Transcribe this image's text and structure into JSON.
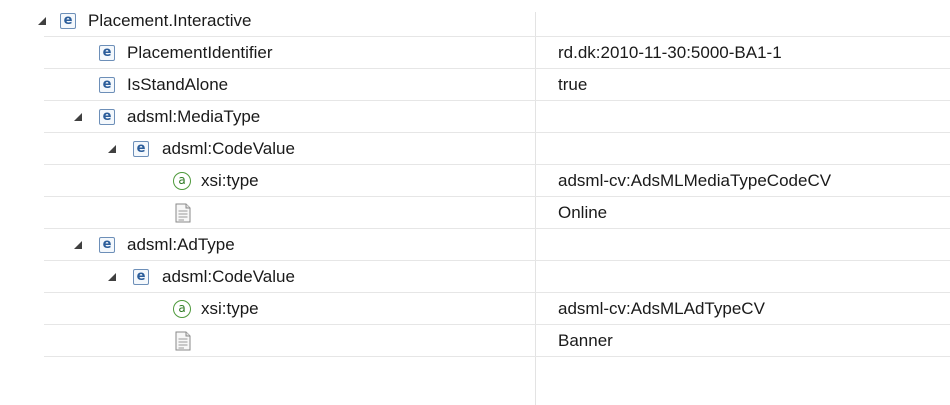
{
  "rows": [
    {
      "name": "Placement.Interactive",
      "value": "",
      "icon": "element",
      "expanded": true
    },
    {
      "name": "PlacementIdentifier",
      "value": "rd.dk:2010-11-30:5000-BA1-1",
      "icon": "element"
    },
    {
      "name": "IsStandAlone",
      "value": "true",
      "icon": "element"
    },
    {
      "name": "adsml:MediaType",
      "value": "",
      "icon": "element",
      "expanded": true
    },
    {
      "name": "adsml:CodeValue",
      "value": "",
      "icon": "element",
      "expanded": true
    },
    {
      "name": "xsi:type",
      "value": "adsml-cv:AdsMLMediaTypeCodeCV",
      "icon": "attribute"
    },
    {
      "name": "",
      "value": "Online",
      "icon": "text-node"
    },
    {
      "name": "adsml:AdType",
      "value": "",
      "icon": "element",
      "expanded": true
    },
    {
      "name": "adsml:CodeValue",
      "value": "",
      "icon": "element",
      "expanded": true
    },
    {
      "name": "xsi:type",
      "value": "adsml-cv:AdsMLAdTypeCV",
      "icon": "attribute"
    },
    {
      "name": "",
      "value": "Banner",
      "icon": "text-node"
    }
  ],
  "icon_glyphs": {
    "element": "e",
    "attribute": "a"
  },
  "colors": {
    "element_icon": "#2b5d9a",
    "attribute_icon": "#4f9a3c",
    "grid": "#e6e6e6"
  }
}
